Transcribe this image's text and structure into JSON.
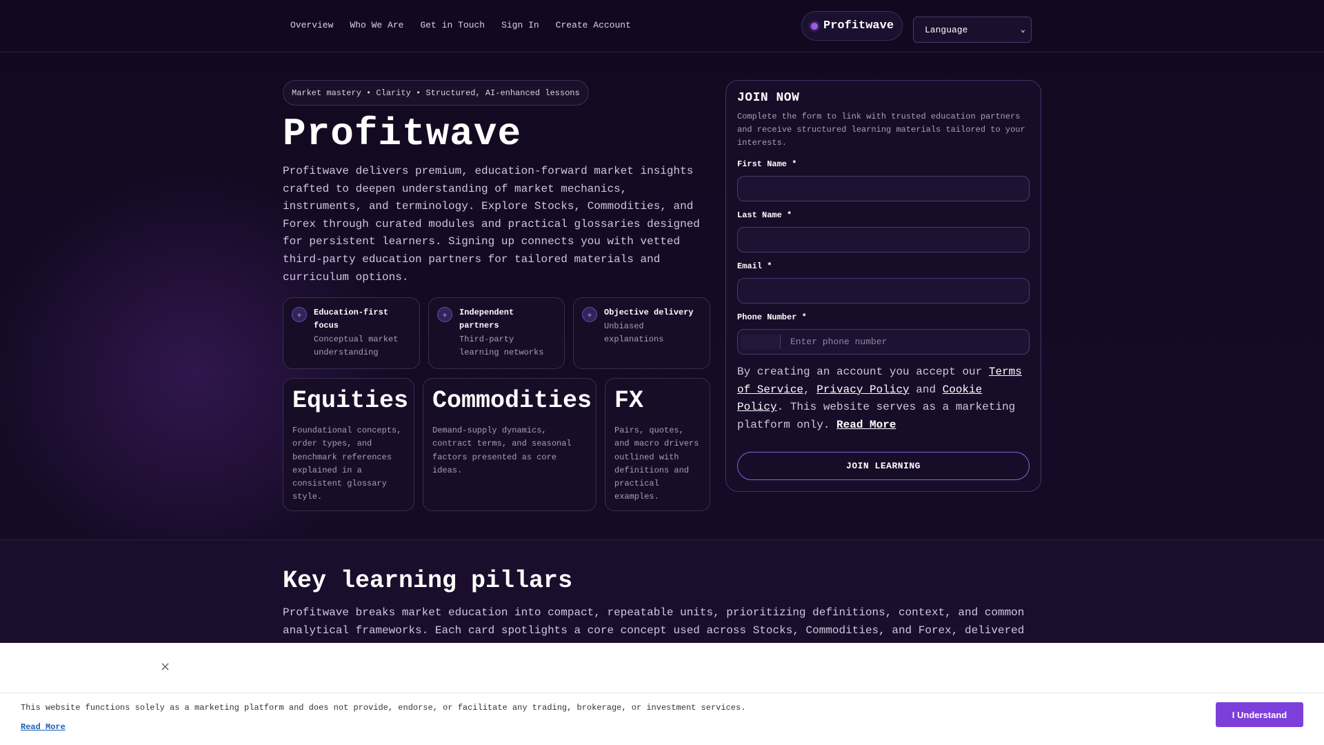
{
  "nav": {
    "items": [
      "Overview",
      "Who We Are",
      "Get in Touch",
      "Sign In",
      "Create Account"
    ]
  },
  "brand": {
    "name": "Profitwave"
  },
  "language": {
    "selected": "Language"
  },
  "hero": {
    "tagline": "Market mastery • Clarity • Structured, AI-enhanced lessons",
    "title": "Profitwave",
    "description": "Profitwave delivers premium, education-forward market insights crafted to deepen understanding of market mechanics, instruments, and terminology. Explore Stocks, Commodities, and Forex through curated modules and practical glossaries designed for persistent learners. Signing up connects you with vetted third-party education partners for tailored materials and curriculum options."
  },
  "features": [
    {
      "icon": "sparkle-icon",
      "title": "Education-first focus",
      "subtitle": "Conceptual market understanding"
    },
    {
      "icon": "sparkle-icon",
      "title": "Independent partners",
      "subtitle": "Third-party learning networks"
    },
    {
      "icon": "sparkle-icon",
      "title": "Objective delivery",
      "subtitle": "Unbiased explanations"
    }
  ],
  "markets": [
    {
      "title": "Equities",
      "description": "Foundational concepts, order types, and benchmark references explained in a consistent glossary style."
    },
    {
      "title": "Commodities",
      "description": "Demand-supply dynamics, contract terms, and seasonal factors presented as core ideas."
    },
    {
      "title": "FX",
      "description": "Pairs, quotes, and macro drivers outlined with definitions and practical examples."
    }
  ],
  "join": {
    "title": "JOIN NOW",
    "subtitle": "Complete the form to link with trusted education partners and receive structured learning materials tailored to your interests.",
    "first_name_label": "First Name *",
    "last_name_label": "Last Name *",
    "email_label": "Email *",
    "phone_label": "Phone Number *",
    "phone_placeholder": "Enter phone number",
    "consent_prefix": "By creating an account you accept our ",
    "terms_link": "Terms of Service",
    "sep1": ", ",
    "privacy_link": "Privacy Policy",
    "sep2": " and ",
    "cookie_link": "Cookie Policy",
    "consent_suffix": ". This website serves as a marketing platform only. ",
    "read_more": "Read More",
    "button": "JOIN LEARNING"
  },
  "pillars": {
    "title": "Key learning pillars",
    "description": "Profitwave breaks market education into compact, repeatable units, prioritizing definitions, context, and common analytical frameworks. Each card spotlights a core concept used across Stocks, Commodities, and Forex, delivered"
  },
  "banner": {
    "close_glyph": "×",
    "text": "This website functions solely as a marketing platform and does not provide, endorse, or facilitate any trading, brokerage, or investment services.",
    "link": "Read More",
    "button": "I Understand"
  },
  "colors": {
    "accent": "#7c3fd9",
    "background": "#140a22",
    "card": "#170d27"
  }
}
